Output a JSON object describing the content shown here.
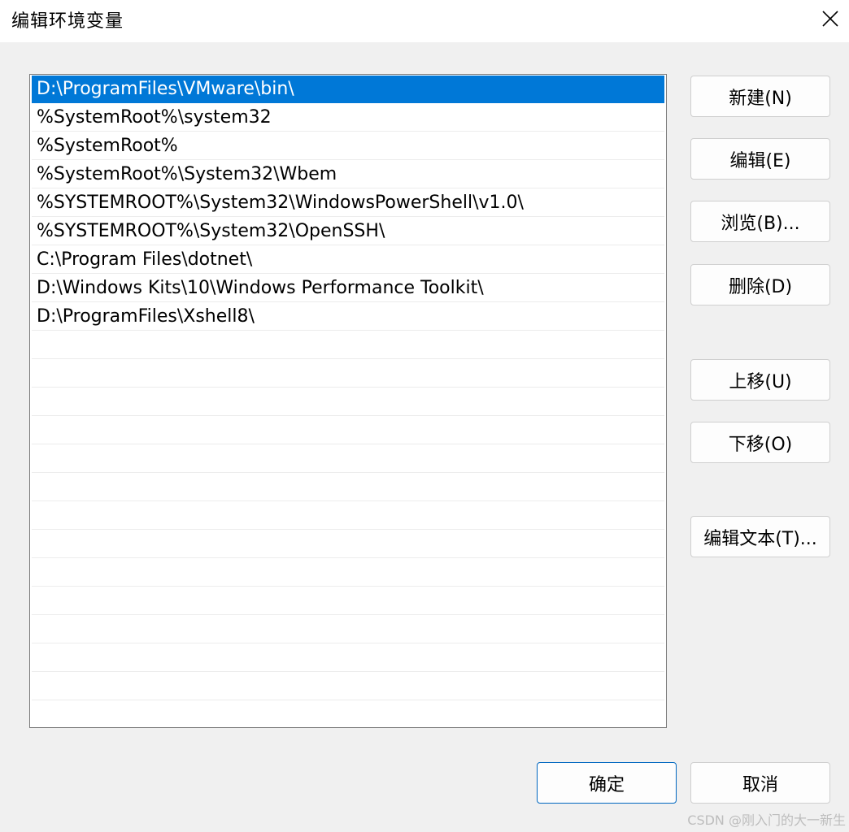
{
  "window": {
    "title": "编辑环境变量"
  },
  "paths": [
    "D:\\ProgramFiles\\VMware\\bin\\",
    "%SystemRoot%\\system32",
    "%SystemRoot%",
    "%SystemRoot%\\System32\\Wbem",
    "%SYSTEMROOT%\\System32\\WindowsPowerShell\\v1.0\\",
    "%SYSTEMROOT%\\System32\\OpenSSH\\",
    "C:\\Program Files\\dotnet\\",
    "D:\\Windows Kits\\10\\Windows Performance Toolkit\\",
    "D:\\ProgramFiles\\Xshell8\\"
  ],
  "selected_index": 0,
  "buttons": {
    "new": "新建(N)",
    "edit": "编辑(E)",
    "browse": "浏览(B)...",
    "delete": "删除(D)",
    "move_up": "上移(U)",
    "move_down": "下移(O)",
    "edit_text": "编辑文本(T)...",
    "ok": "确定",
    "cancel": "取消"
  },
  "watermark": "CSDN @刚入门的大一新生",
  "colors": {
    "selection": "#0078d7",
    "primary_border": "#0067c0"
  }
}
